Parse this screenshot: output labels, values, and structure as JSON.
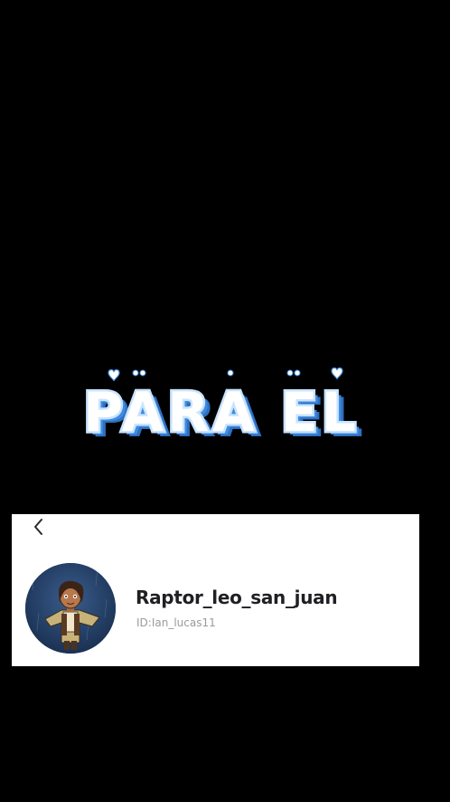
{
  "overlay": {
    "title": "PARA EL",
    "text_fill": "#ffffff",
    "shadow_color": "#3f8ce0",
    "outline_color": "#c9e4ff"
  },
  "profile": {
    "back_icon": "chevron-left-icon",
    "avatar_icon": "cartoon-character-avatar",
    "username": "Raptor_leo_san_juan",
    "user_id": "ID:Ian_lucas11"
  },
  "colors": {
    "background": "#000000",
    "card": "#ffffff",
    "username": "#1f1f24",
    "user_id": "#9b9b9f"
  }
}
